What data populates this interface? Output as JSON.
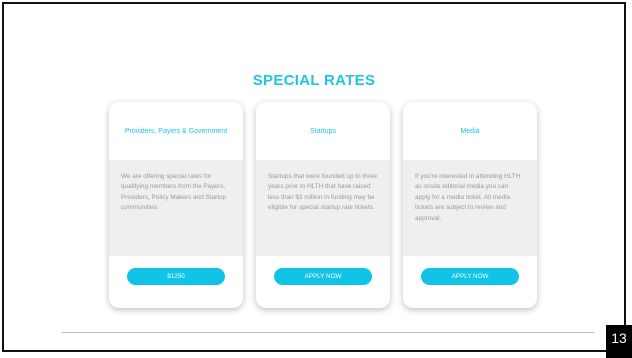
{
  "slide": {
    "title": "SPECIAL RATES",
    "page_number": "13"
  },
  "cards": [
    {
      "heading": "Providers, Payers & Government",
      "body": "We are offering special rates for qualifying members from the Payers, Providers, Policy Makers and Startup communities.",
      "button_label": "$1250"
    },
    {
      "heading": "Startups",
      "body": "Startups that were founded up to three years prior to HLTH that have raised less than $3 million in funding may be eligible for special startup rate tickets.",
      "button_label": "APPLY NOW"
    },
    {
      "heading": "Media",
      "body": "If you're interested in attending HLTH as onsite editorial media you can apply for a media ticket. All media tickets are subject to review and approval.",
      "button_label": "APPLY NOW"
    }
  ],
  "colors": {
    "accent": "#21c4e6",
    "button": "#12c3e8",
    "card_body_bg": "#efefef",
    "body_text": "#9a9a9a"
  }
}
